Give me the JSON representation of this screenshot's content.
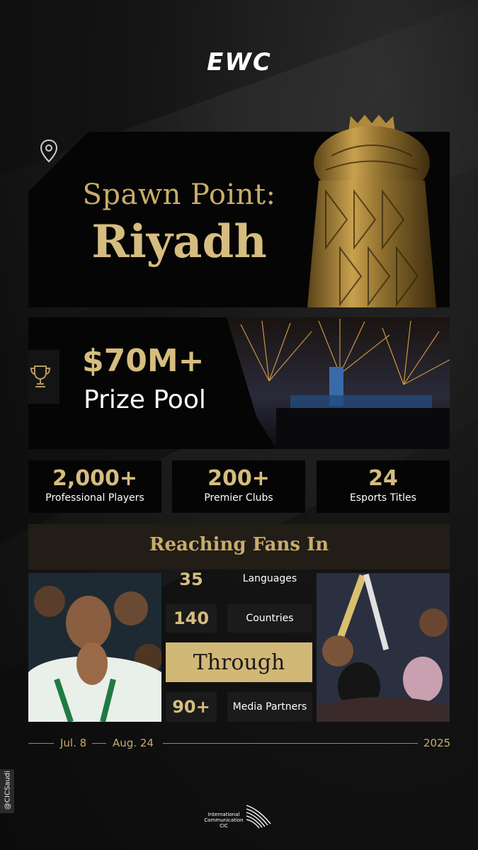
{
  "brand": {
    "logo_text": "EWC",
    "accent": "#d6bd7f",
    "accent_dark": "#c9ac6b"
  },
  "hero": {
    "icon": "location-pin-icon",
    "title_line1": "Spawn Point:",
    "title_line2": "Riyadh"
  },
  "prize": {
    "icon": "trophy-cup-icon",
    "amount": "$70M+",
    "label": "Prize Pool"
  },
  "stats": [
    {
      "value": "2,000+",
      "label": "Professional Players"
    },
    {
      "value": "200+",
      "label": "Premier Clubs"
    },
    {
      "value": "24",
      "label": "Esports Titles"
    }
  ],
  "reach": {
    "title": "Reaching Fans In",
    "rows": [
      {
        "value": "35",
        "label": "Languages"
      },
      {
        "value": "140",
        "label": "Countries"
      }
    ],
    "through": "Through",
    "partners": {
      "value": "90+",
      "label": "Media Partners"
    }
  },
  "timeline": {
    "start": "Jul. 8",
    "end": "Aug. 24",
    "year": "2025"
  },
  "footer": {
    "handle": "@CICSaudi",
    "org_line1": "International",
    "org_line2": "Communication",
    "org_line3": "CIC"
  }
}
